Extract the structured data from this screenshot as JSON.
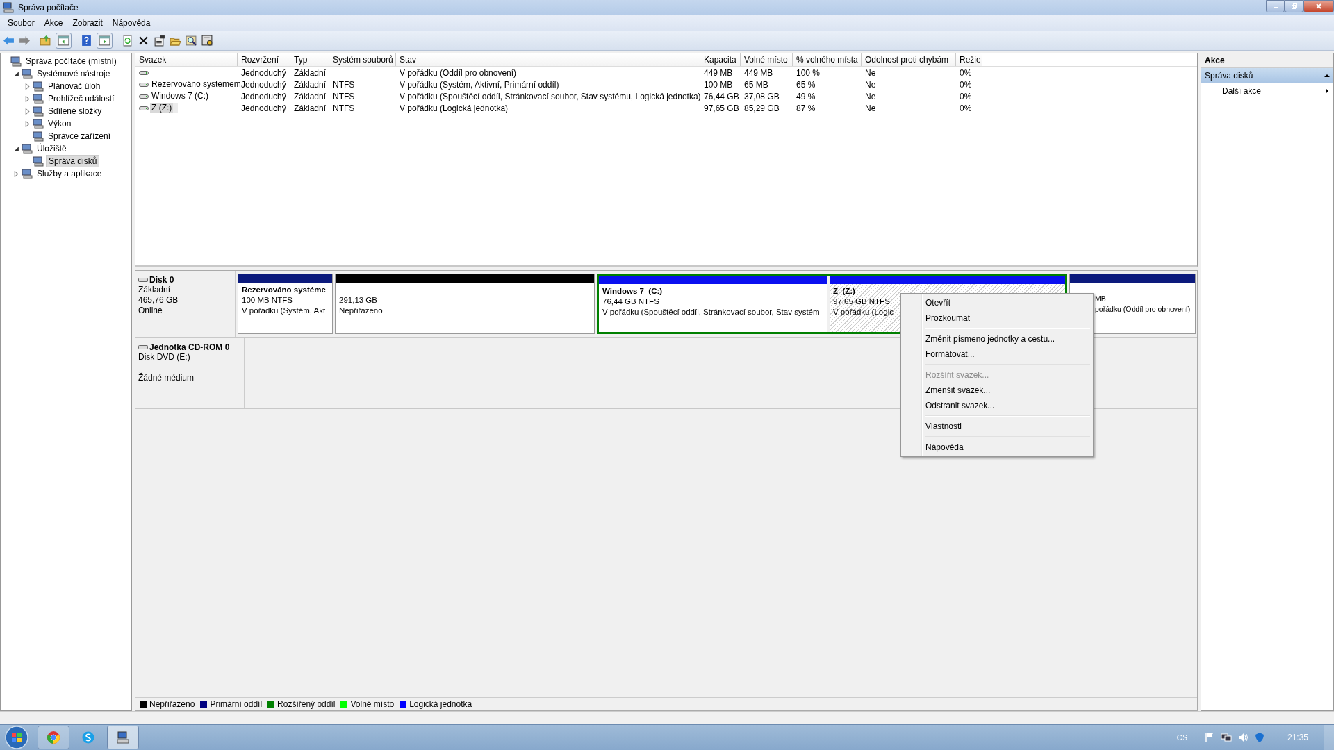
{
  "window": {
    "title": "Správa počítače"
  },
  "menu_bar": [
    "Soubor",
    "Akce",
    "Zobrazit",
    "Nápověda"
  ],
  "tree": [
    {
      "label": "Správa počítače (místní)",
      "selected": false,
      "children": [
        {
          "label": "Systémové nástroje",
          "expanded": true,
          "selected": false,
          "children": [
            {
              "label": "Plánovač úloh",
              "expanded": false,
              "selected": false
            },
            {
              "label": "Prohlížeč událostí",
              "expanded": false,
              "selected": false
            },
            {
              "label": "Sdílené složky",
              "expanded": false,
              "selected": false
            },
            {
              "label": "Výkon",
              "expanded": false,
              "selected": false
            },
            {
              "label": "Správce zařízení",
              "selected": false
            }
          ]
        },
        {
          "label": "Úložiště",
          "expanded": true,
          "selected": false,
          "children": [
            {
              "label": "Správa disků",
              "selected": true
            }
          ]
        },
        {
          "label": "Služby a aplikace",
          "expanded": false,
          "selected": false
        }
      ]
    }
  ],
  "table": {
    "columns": [
      "Svazek",
      "Rozvržení",
      "Typ",
      "Systém souborů",
      "Stav",
      "Kapacita",
      "Volné místo",
      "% volného místa",
      "Odolnost proti chybám",
      "Režie"
    ],
    "rows": [
      {
        "selected": false,
        "cells": [
          "",
          "Jednoduchý",
          "Základní",
          "",
          "V pořádku (Oddíl pro obnovení)",
          "449 MB",
          "449 MB",
          "100 %",
          "Ne",
          "0%"
        ]
      },
      {
        "selected": false,
        "cells": [
          "Rezervováno systémem",
          "Jednoduchý",
          "Základní",
          "NTFS",
          "V pořádku (Systém, Aktivní, Primární oddíl)",
          "100 MB",
          "65 MB",
          "65 %",
          "Ne",
          "0%"
        ]
      },
      {
        "selected": false,
        "cells": [
          "Windows 7 (C:)",
          "Jednoduchý",
          "Základní",
          "NTFS",
          "V pořádku (Spouštěcí oddíl, Stránkovací soubor, Stav systému, Logická jednotka)",
          "76,44 GB",
          "37,08 GB",
          "49 %",
          "Ne",
          "0%"
        ]
      },
      {
        "selected": true,
        "cells": [
          "Z (Z:)",
          "Jednoduchý",
          "Základní",
          "NTFS",
          "V pořádku (Logická jednotka)",
          "97,65 GB",
          "85,29 GB",
          "87 %",
          "Ne",
          "0%"
        ]
      }
    ]
  },
  "disks": [
    {
      "name": "Disk 0",
      "lines": [
        "Základní",
        "465,76 GB",
        "Online"
      ],
      "segments": [
        {
          "kind": "primary",
          "selected": false,
          "name": "Rezervováno systéme",
          "size": "100 MB NTFS",
          "status": "V pořádku (Systém, Akt"
        },
        {
          "kind": "unallocated",
          "selected": false,
          "size": "291,13 GB",
          "status": "Nepřiřazeno"
        },
        {
          "kind": "extended",
          "parts": [
            {
              "kind": "logical",
              "selected": false,
              "name": "Windows 7  (C:)",
              "size": "76,44 GB NTFS",
              "status": "V pořádku (Spouštěcí oddíl, Stránkovací soubor, Stav systém"
            },
            {
              "kind": "logical",
              "selected": true,
              "name": "Z  (Z:)",
              "size": "97,65 GB NTFS",
              "status": "V pořádku (Logic"
            }
          ]
        },
        {
          "kind": "primary",
          "selected": false,
          "size": "MB",
          "status": "pořádku (Oddíl pro obnovení)"
        }
      ]
    },
    {
      "name": "Jednotka CD-ROM 0",
      "lines": [
        "Disk DVD (E:)",
        "Žádné médium"
      ]
    }
  ],
  "legend": [
    {
      "label": "Nepřiřazeno",
      "color": "#000000"
    },
    {
      "label": "Primární oddíl",
      "color": "#000080"
    },
    {
      "label": "Rozšířený oddíl",
      "color": "#008000"
    },
    {
      "label": "Volné místo",
      "color": "#00ff00"
    },
    {
      "label": "Logická jednotka",
      "color": "#0000ff"
    }
  ],
  "context_menu": [
    [
      {
        "label": "Otevřít",
        "disabled": false
      },
      {
        "label": "Prozkoumat",
        "disabled": false
      }
    ],
    [
      {
        "label": "Změnit písmeno jednotky a cestu...",
        "disabled": false
      },
      {
        "label": "Formátovat...",
        "disabled": false
      }
    ],
    [
      {
        "label": "Rozšířit svazek...",
        "disabled": true
      },
      {
        "label": "Zmenšit svazek...",
        "disabled": false
      },
      {
        "label": "Odstranit svazek...",
        "disabled": false
      }
    ],
    [
      {
        "label": "Vlastnosti",
        "disabled": false
      }
    ],
    [
      {
        "label": "Nápověda",
        "disabled": false
      }
    ]
  ],
  "actions": {
    "title": "Akce",
    "section": {
      "label": "Správa disků",
      "expanded": true
    },
    "items": [
      "Další akce"
    ]
  },
  "taskbar": {
    "language": "CS",
    "time": "21:35"
  }
}
